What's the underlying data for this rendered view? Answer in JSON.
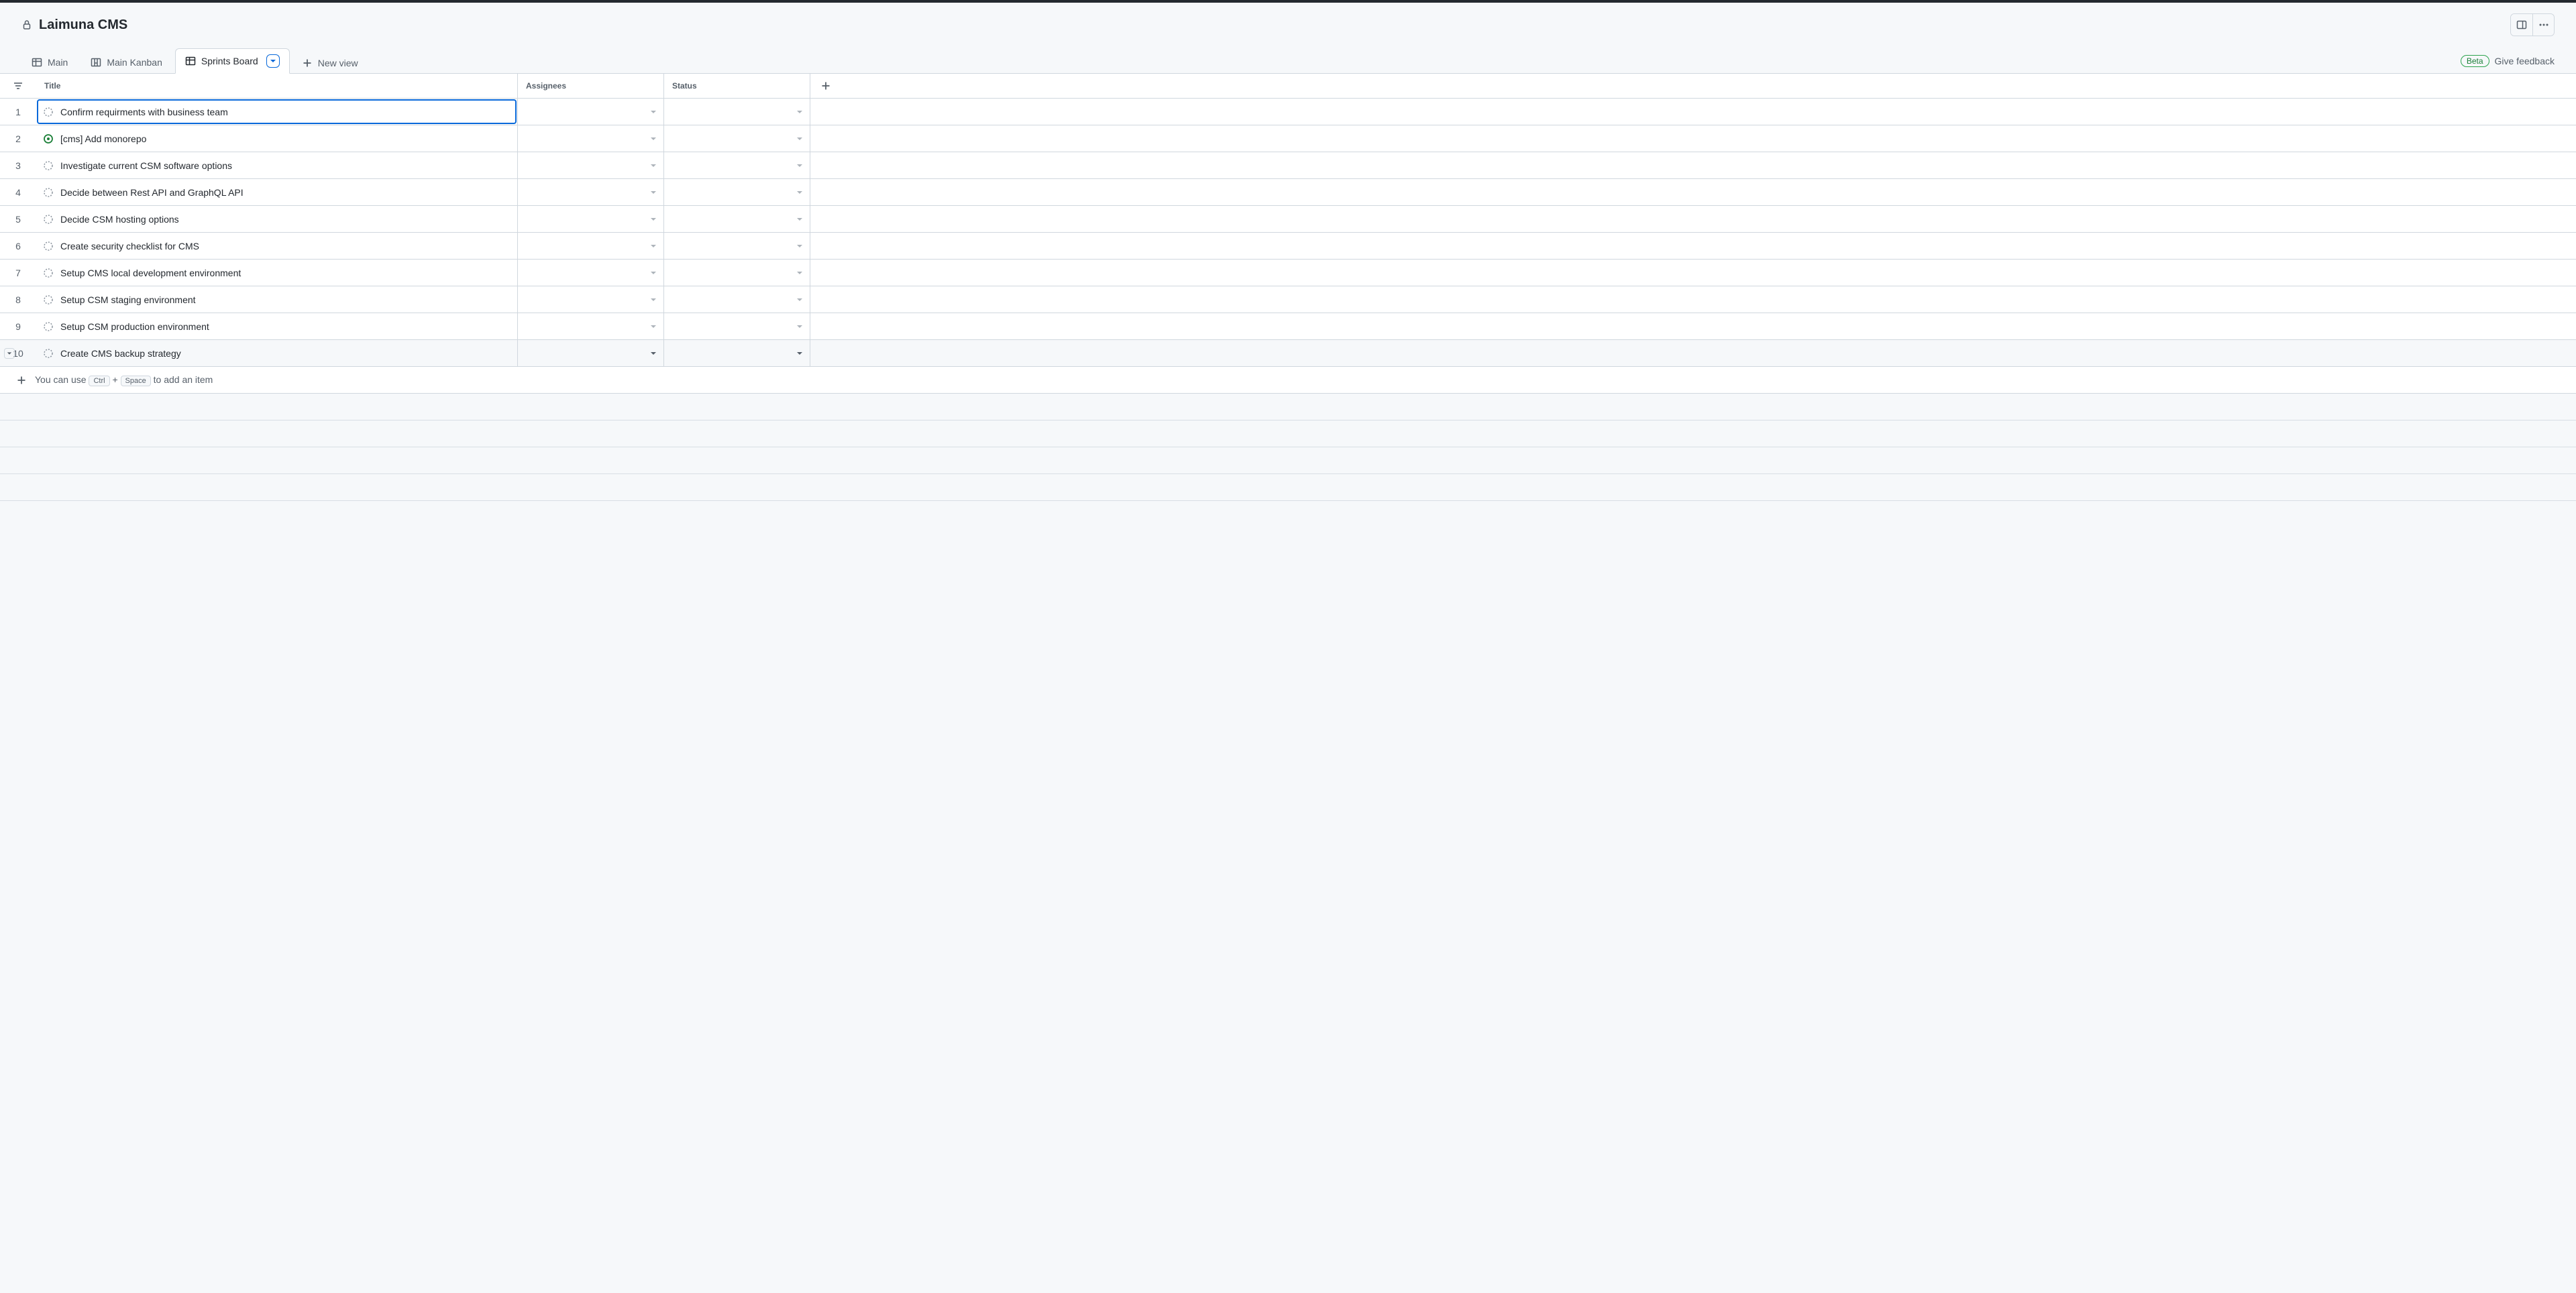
{
  "project": {
    "title": "Laimuna CMS"
  },
  "tabs": [
    {
      "label": "Main",
      "icon": "table",
      "active": false
    },
    {
      "label": "Main Kanban",
      "icon": "kanban",
      "active": false
    },
    {
      "label": "Sprints Board",
      "icon": "table",
      "active": true
    }
  ],
  "new_view_label": "New view",
  "columns": {
    "title": "Title",
    "assignees": "Assignees",
    "status": "Status"
  },
  "rows": [
    {
      "num": "1",
      "title": "Confirm requirments with business team",
      "icon": "draft",
      "selected": true
    },
    {
      "num": "2",
      "title": "[cms] Add monorepo",
      "icon": "open",
      "selected": false
    },
    {
      "num": "3",
      "title": "Investigate current CSM software options",
      "icon": "draft",
      "selected": false
    },
    {
      "num": "4",
      "title": "Decide between Rest API and GraphQL API",
      "icon": "draft",
      "selected": false
    },
    {
      "num": "5",
      "title": "Decide CSM hosting options",
      "icon": "draft",
      "selected": false
    },
    {
      "num": "6",
      "title": "Create security checklist for CMS",
      "icon": "draft",
      "selected": false
    },
    {
      "num": "7",
      "title": "Setup CMS local development environment",
      "icon": "draft",
      "selected": false
    },
    {
      "num": "8",
      "title": "Setup CSM staging environment",
      "icon": "draft",
      "selected": false
    },
    {
      "num": "9",
      "title": "Setup CSM production environment",
      "icon": "draft",
      "selected": false
    },
    {
      "num": "10",
      "title": "Create CMS backup strategy",
      "icon": "draft",
      "selected": false,
      "hovered": true
    }
  ],
  "add_hint": {
    "pre": "You can use",
    "k1": "Ctrl",
    "plus": "+",
    "k2": "Space",
    "post": "to add an item"
  },
  "beta_label": "Beta",
  "feedback_label": "Give feedback"
}
